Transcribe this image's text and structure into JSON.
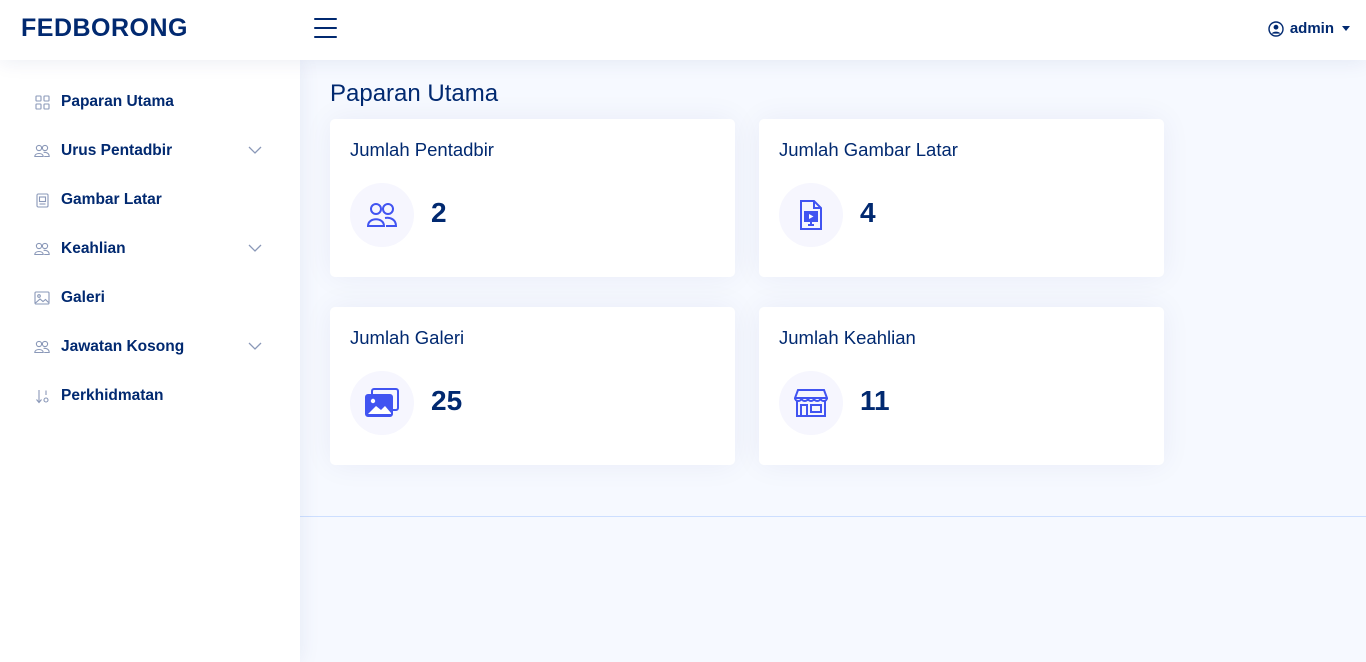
{
  "header": {
    "logo": "FEDBORONG",
    "user_name": "admin",
    "icons": {
      "menu": "hamburger-icon",
      "user": "user-circle-icon",
      "dropdown": "caret-down-icon"
    }
  },
  "sidebar": {
    "items": [
      {
        "label": "Paparan Utama",
        "icon": "grid-icon",
        "has_submenu": false
      },
      {
        "label": "Urus Pentadbir",
        "icon": "people-icon",
        "has_submenu": true
      },
      {
        "label": "Gambar Latar",
        "icon": "file-image-icon",
        "has_submenu": false
      },
      {
        "label": "Keahlian",
        "icon": "people-icon",
        "has_submenu": true
      },
      {
        "label": "Galeri",
        "icon": "image-icon",
        "has_submenu": false
      },
      {
        "label": "Jawatan Kosong",
        "icon": "people-icon",
        "has_submenu": true
      },
      {
        "label": "Perkhidmatan",
        "icon": "sort-numeric-icon",
        "has_submenu": false
      }
    ]
  },
  "main": {
    "title": "Paparan Utama",
    "cards": [
      {
        "title": "Jumlah Pentadbir",
        "value": "2",
        "icon": "people-icon"
      },
      {
        "title": "Jumlah Gambar Latar",
        "value": "4",
        "icon": "file-slides-icon"
      },
      {
        "title": "Jumlah Galeri",
        "value": "25",
        "icon": "images-icon"
      },
      {
        "title": "Jumlah Keahlian",
        "value": "11",
        "icon": "shop-icon"
      }
    ]
  },
  "colors": {
    "primary": "#012970",
    "accent": "#4154f1",
    "background": "#f6f9ff",
    "icon_bg": "#f6f6fe"
  }
}
